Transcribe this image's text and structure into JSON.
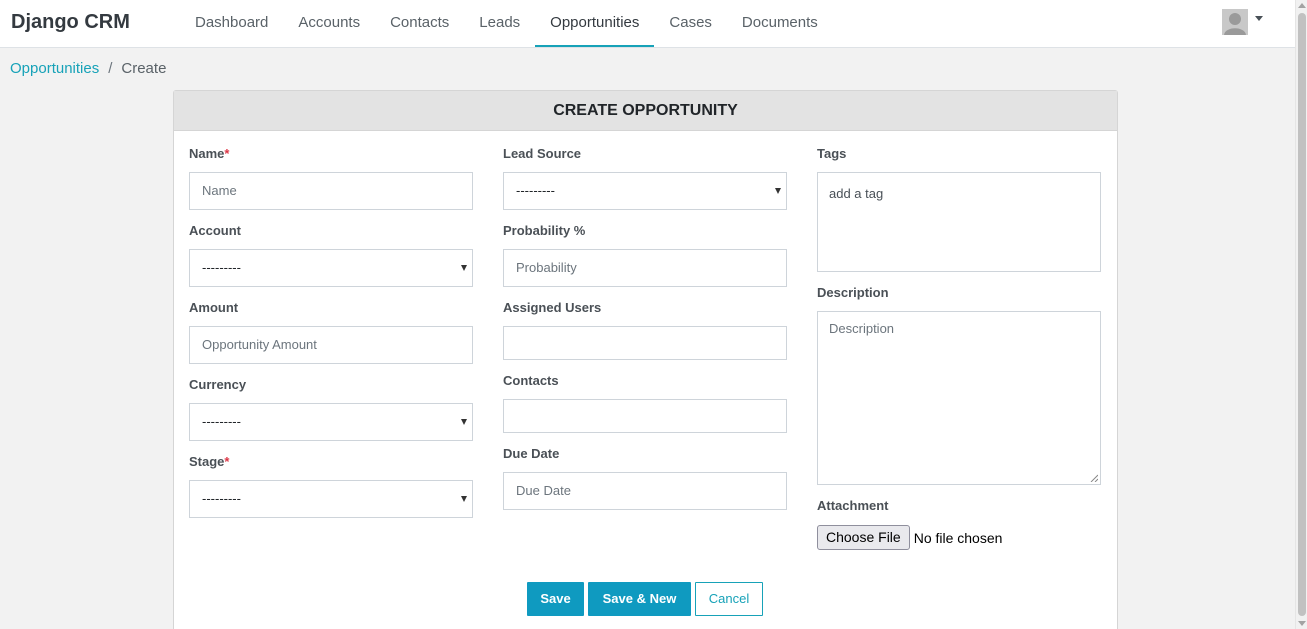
{
  "app": {
    "brand": "Django CRM"
  },
  "nav": {
    "items": [
      {
        "label": "Dashboard"
      },
      {
        "label": "Accounts"
      },
      {
        "label": "Contacts"
      },
      {
        "label": "Leads"
      },
      {
        "label": "Opportunities",
        "active": true
      },
      {
        "label": "Cases"
      },
      {
        "label": "Documents"
      }
    ]
  },
  "breadcrumb": {
    "parent": "Opportunities",
    "separator": "/",
    "current": "Create"
  },
  "form": {
    "title": "CREATE OPPORTUNITY",
    "name": {
      "label": "Name",
      "required_mark": "*",
      "placeholder": "Name"
    },
    "account": {
      "label": "Account",
      "value": "---------"
    },
    "amount": {
      "label": "Amount",
      "placeholder": "Opportunity Amount"
    },
    "currency": {
      "label": "Currency",
      "value": "---------"
    },
    "stage": {
      "label": "Stage",
      "required_mark": "*",
      "value": "---------"
    },
    "lead_source": {
      "label": "Lead Source",
      "value": "---------"
    },
    "probability": {
      "label": "Probability %",
      "placeholder": "Probability"
    },
    "assigned_users": {
      "label": "Assigned Users"
    },
    "contacts": {
      "label": "Contacts"
    },
    "due_date": {
      "label": "Due Date",
      "placeholder": "Due Date"
    },
    "tags": {
      "label": "Tags",
      "placeholder": "add a tag"
    },
    "description": {
      "label": "Description",
      "placeholder": "Description"
    },
    "attachment": {
      "label": "Attachment",
      "button": "Choose File",
      "status": "No file chosen"
    }
  },
  "actions": {
    "save": "Save",
    "save_new": "Save & New",
    "cancel": "Cancel"
  },
  "colors": {
    "accent": "#17a2b8",
    "button": "#0f9ac0",
    "required": "#dc3545"
  }
}
